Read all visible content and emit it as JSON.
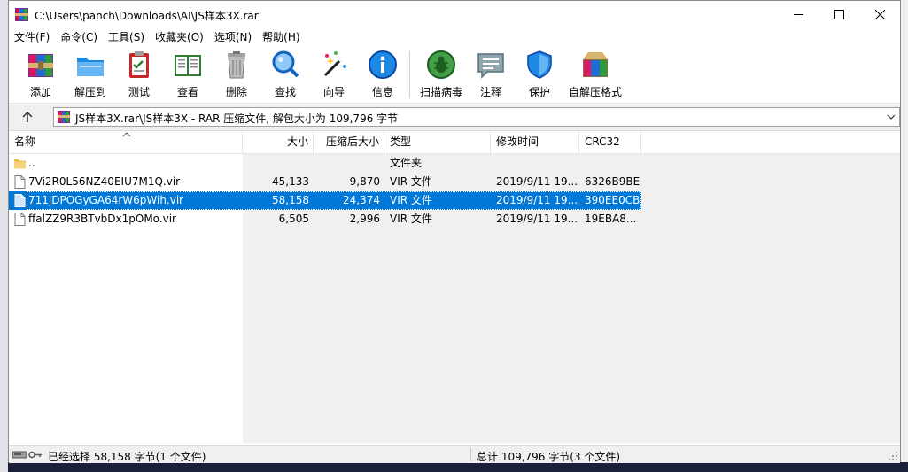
{
  "window": {
    "title": "C:\\Users\\panch\\Downloads\\AI\\JS样本3X.rar"
  },
  "menu": [
    {
      "label": "文件(F)"
    },
    {
      "label": "命令(C)"
    },
    {
      "label": "工具(S)"
    },
    {
      "label": "收藏夹(O)"
    },
    {
      "label": "选项(N)"
    },
    {
      "label": "帮助(H)"
    }
  ],
  "toolbar": [
    {
      "label": "添加",
      "icon": "add-archive-icon"
    },
    {
      "label": "解压到",
      "icon": "extract-folder-icon"
    },
    {
      "label": "测试",
      "icon": "test-clipboard-icon"
    },
    {
      "label": "查看",
      "icon": "view-book-icon"
    },
    {
      "label": "删除",
      "icon": "trash-icon"
    },
    {
      "label": "查找",
      "icon": "find-magnifier-icon"
    },
    {
      "label": "向导",
      "icon": "wizard-wand-icon"
    },
    {
      "label": "信息",
      "icon": "info-icon"
    },
    {
      "label": "扫描病毒",
      "icon": "virus-scan-icon"
    },
    {
      "label": "注释",
      "icon": "comment-icon"
    },
    {
      "label": "保护",
      "icon": "shield-icon"
    },
    {
      "label": "自解压格式",
      "icon": "sfx-box-icon"
    }
  ],
  "address": {
    "path": "JS样本3X.rar\\JS样本3X - RAR 压缩文件, 解包大小为 109,796 字节"
  },
  "columns": {
    "name": "名称",
    "size": "大小",
    "packed": "压缩后大小",
    "type": "类型",
    "modified": "修改时间",
    "crc": "CRC32"
  },
  "files": [
    {
      "name": "..",
      "size": "",
      "packed": "",
      "type": "文件夹",
      "modified": "",
      "crc": "",
      "kind": "folder",
      "selected": false
    },
    {
      "name": "7Vi2R0L56NZ40EIU7M1Q.vir",
      "size": "45,133",
      "packed": "9,870",
      "type": "VIR 文件",
      "modified": "2019/9/11 19...",
      "crc": "6326B9BE",
      "kind": "file",
      "selected": false
    },
    {
      "name": "711jDPOGyGA64rW6pWih.vir",
      "size": "58,158",
      "packed": "24,374",
      "type": "VIR 文件",
      "modified": "2019/9/11 19...",
      "crc": "390EE0CB",
      "kind": "file",
      "selected": true
    },
    {
      "name": "ffalZZ9R3BTvbDx1pOMo.vir",
      "size": "6,505",
      "packed": "2,996",
      "type": "VIR 文件",
      "modified": "2019/9/11 19...",
      "crc": "19EBA8...",
      "kind": "file",
      "selected": false
    }
  ],
  "status": {
    "left": "已经选择 58,158 字节(1 个文件)",
    "right": "总计 109,796 字节(3 个文件)"
  },
  "colors": {
    "selection": "#0078d7"
  }
}
